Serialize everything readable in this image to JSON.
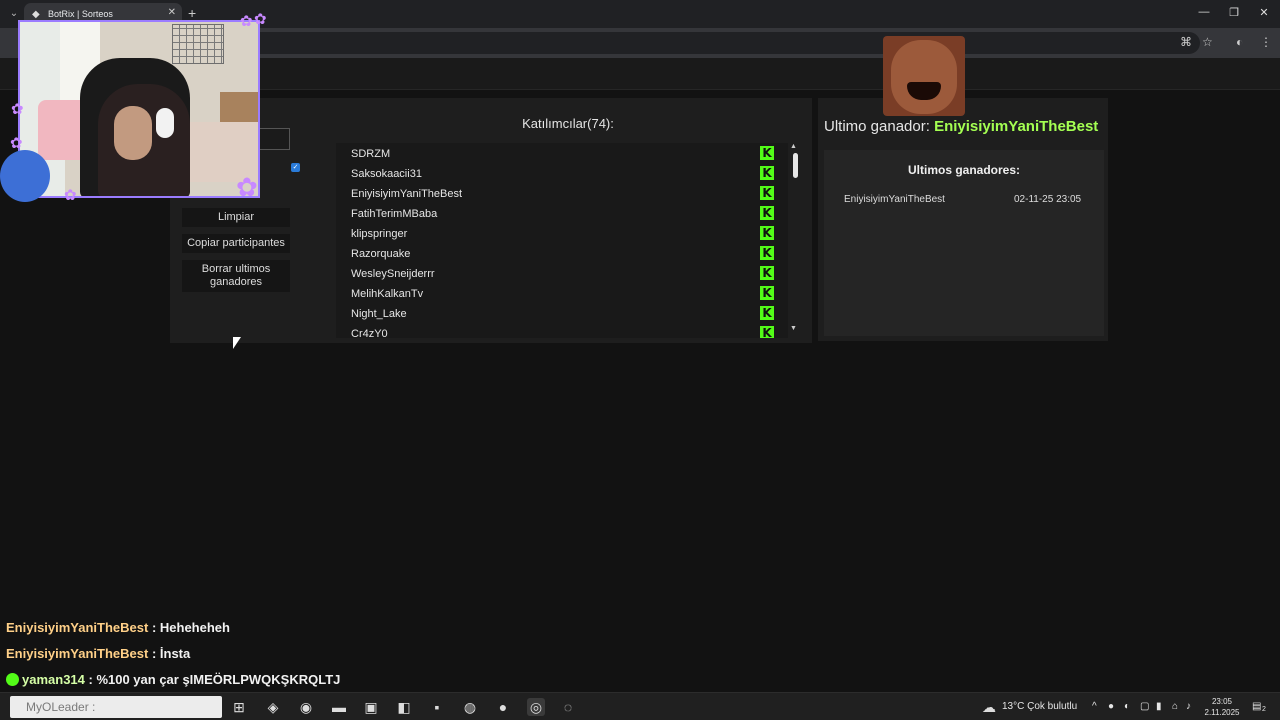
{
  "browser": {
    "tab_title": "BotRix | Sorteos",
    "new_tab": "+",
    "window_controls": {
      "minimize": "—",
      "restore": "❐",
      "close": "✕"
    }
  },
  "left_panel": {
    "buttons": [
      "Limpiar",
      "Copiar participantes",
      "Borrar ultimos ganadores"
    ]
  },
  "participants": {
    "title": "Katılımcılar(74):",
    "platform_icon": "K",
    "items": [
      "SDRZM",
      "Saksokaacii31",
      "EniyisiyimYaniTheBest",
      "FatihTerimMBaba",
      "klipspringer",
      "Razorquake",
      "WesleySneijderrr",
      "MelihKalkanTv",
      "Night_Lake",
      "Cr4zY0"
    ]
  },
  "winner": {
    "label": "Ultimo ganador:",
    "name": "EniyisiyimYaniTheBest",
    "history_title": "Ultimos ganadores:",
    "history": [
      {
        "name": "EniyisiyimYaniTheBest",
        "date": "02-11-25 23:05"
      }
    ]
  },
  "chat": {
    "messages": [
      {
        "user": "EniyisiyimYaniTheBest",
        "text": " : Heheheheh"
      },
      {
        "user": "EniyisiyimYaniTheBest",
        "text": " : İnsta"
      },
      {
        "user": "yaman314",
        "text": " : %100 yan çar şIMEÖRLPWQKŞKRQLTJ"
      }
    ]
  },
  "taskbar": {
    "search_placeholder": "MyOLeader :",
    "weather": "13°C  Çok bulutlu",
    "time": "23:05",
    "date": "2.11.2025",
    "notification_count": "2"
  },
  "colors": {
    "kick_green": "#53fc18",
    "winner_green": "#a4ff52",
    "accent_purple": "#9b7cff"
  }
}
